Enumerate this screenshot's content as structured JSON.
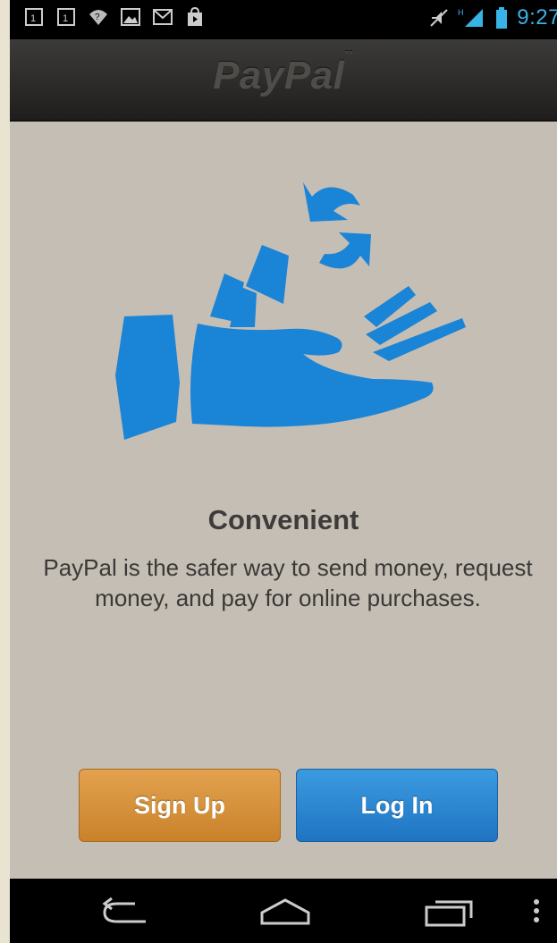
{
  "status_bar": {
    "time": "9:27",
    "left_icons": [
      "notification-1-icon",
      "notification-1-icon",
      "wifi-question-icon",
      "image-icon",
      "gmail-icon",
      "store-bag-icon"
    ],
    "right_icons": [
      "mute-icon",
      "signal-icon",
      "battery-icon"
    ],
    "signal_label": "H",
    "accent_color": "#39b3e6"
  },
  "header": {
    "logo_text": "PayPal",
    "trademark": "™"
  },
  "main": {
    "heading": "Convenient",
    "description": "PayPal is the safer way to send money, request money, and pay for online purchases.",
    "illustration": "hand-money-icon",
    "illustration_color": "#1a84d6"
  },
  "actions": {
    "signup_label": "Sign Up",
    "login_label": "Log In"
  },
  "nav_bar": {
    "icons": [
      "back-icon",
      "home-icon",
      "recent-apps-icon",
      "overflow-menu-icon"
    ]
  },
  "colors": {
    "background": "#c5beb4",
    "signup_button": "#d4913a",
    "login_button": "#2a86d3"
  }
}
